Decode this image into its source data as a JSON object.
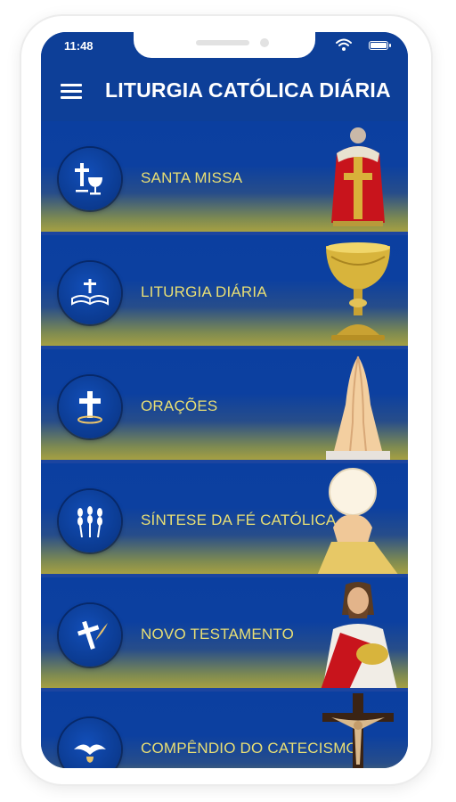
{
  "status_bar": {
    "time": "11:48"
  },
  "header": {
    "title": "LITURGIA CATÓLICA DIÁRIA"
  },
  "menu_items": [
    {
      "label": "SANTA MISSA",
      "icon": "cross-chalice-icon",
      "image": "vestment-image"
    },
    {
      "label": "LITURGIA DIÁRIA",
      "icon": "open-bible-icon",
      "image": "chalice-image"
    },
    {
      "label": "ORAÇÕES",
      "icon": "cross-icon",
      "image": "praying-hands-image"
    },
    {
      "label": "SÍNTESE DA FÉ CATÓLICA",
      "icon": "wheat-icon",
      "image": "host-elevation-image"
    },
    {
      "label": "NOVO TESTAMENTO",
      "icon": "quill-cross-icon",
      "image": "jesus-image"
    },
    {
      "label": "COMPÊNDIO DO CATECISMO",
      "icon": "dove-icon",
      "image": "crucifix-image"
    }
  ],
  "colors": {
    "header_bg": "#0d3f98",
    "label": "#e9df74",
    "item_bg_top": "#0b3fa0",
    "item_bg_bottom": "#a6a043"
  }
}
